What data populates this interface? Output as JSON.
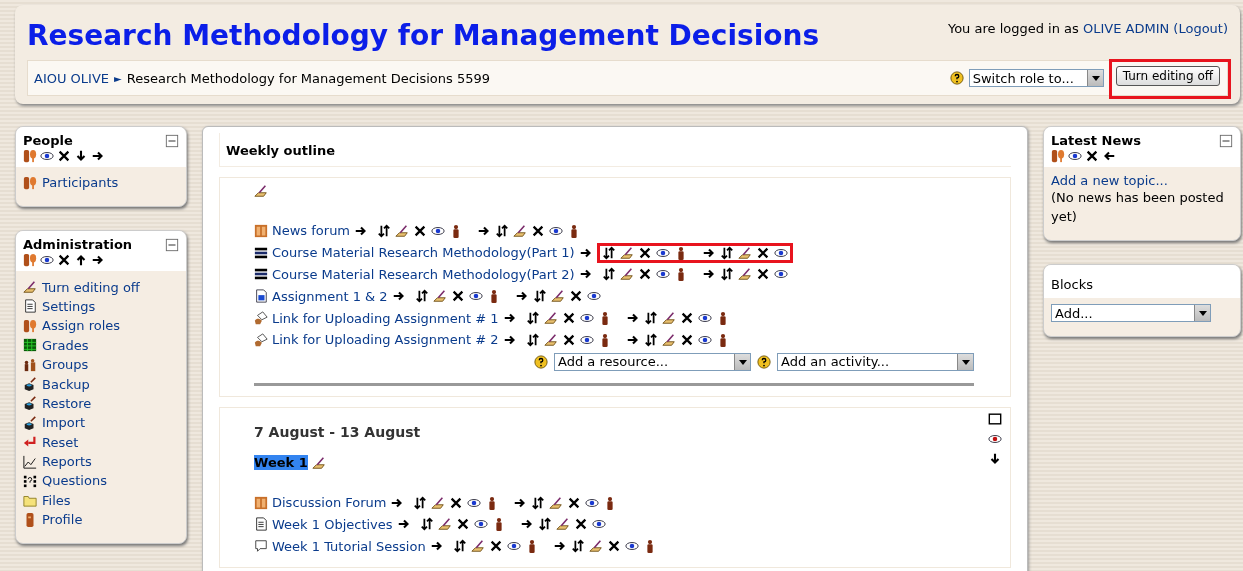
{
  "header": {
    "title": "Research Methodology for Management Decisions",
    "login": {
      "prefix": "You are logged in as",
      "user": "OLIVE ADMIN",
      "logout": "(Logout)"
    },
    "breadcrumb": [
      {
        "label": "AIOU OLIVE",
        "link": true
      },
      {
        "label": "Research Methodology for Management Decisions 5599",
        "link": false
      }
    ],
    "separator": "►",
    "role_select": {
      "value": "Switch role to..."
    },
    "edit_button": {
      "label": "Turn editing off",
      "annotated": true
    }
  },
  "left_blocks": [
    {
      "title": "People",
      "controls": [
        {
          "kind": "roles"
        },
        {
          "kind": "eye"
        },
        {
          "kind": "delete"
        },
        {
          "kind": "down"
        },
        {
          "kind": "right"
        }
      ],
      "items": [
        {
          "kind": "roles",
          "label": "Participants"
        }
      ]
    },
    {
      "title": "Administration",
      "controls": [
        {
          "kind": "roles"
        },
        {
          "kind": "eye"
        },
        {
          "kind": "delete"
        },
        {
          "kind": "up"
        },
        {
          "kind": "right"
        }
      ],
      "items": [
        {
          "kind": "edit",
          "label": "Turn editing off"
        },
        {
          "kind": "page",
          "label": "Settings"
        },
        {
          "kind": "roles",
          "label": "Assign roles"
        },
        {
          "kind": "grades",
          "label": "Grades"
        },
        {
          "kind": "groups",
          "label": "Groups"
        },
        {
          "kind": "box",
          "label": "Backup"
        },
        {
          "kind": "box",
          "label": "Restore"
        },
        {
          "kind": "box",
          "label": "Import"
        },
        {
          "kind": "reset",
          "label": "Reset"
        },
        {
          "kind": "reports",
          "label": "Reports"
        },
        {
          "kind": "questions",
          "label": "Questions"
        },
        {
          "kind": "folder",
          "label": "Files"
        },
        {
          "kind": "profile",
          "label": "Profile"
        }
      ]
    }
  ],
  "outline": {
    "title": "Weekly outline",
    "sections": [
      {
        "activities": [
          {
            "kind": "forum",
            "label": "News forum",
            "annotated": false,
            "control_sets": [
              {
                "group_icon": true
              },
              {
                "group_icon": true
              }
            ]
          },
          {
            "kind": "stack",
            "label": "Course Material Research Methodology(Part 1)",
            "annotated": true,
            "control_sets": [
              {
                "group_icon": true
              },
              {
                "group_icon": false
              }
            ]
          },
          {
            "kind": "stack",
            "label": "Course Material Research Methodology(Part 2)",
            "annotated": false,
            "control_sets": [
              {
                "group_icon": true
              },
              {
                "group_icon": false
              }
            ]
          },
          {
            "kind": "assignment",
            "label": "Assignment 1 & 2",
            "annotated": false,
            "control_sets": [
              {
                "group_icon": true
              },
              {
                "group_icon": false
              }
            ]
          },
          {
            "kind": "link",
            "label": "Link for Uploading Assignment # 1",
            "annotated": false,
            "control_sets": [
              {
                "group_icon": true
              },
              {
                "group_icon": true
              }
            ]
          },
          {
            "kind": "link",
            "label": "Link for Uploading Assignment # 2",
            "annotated": false,
            "control_sets": [
              {
                "group_icon": true
              },
              {
                "group_icon": true
              }
            ]
          }
        ],
        "add_resource": "Add a resource...",
        "add_activity": "Add an activity..."
      },
      {
        "dates": "7 August - 13 August",
        "summary": {
          "label": "Week 1",
          "highlighted": true
        },
        "side_controls": [
          {
            "kind": "square"
          },
          {
            "kind": "eye-red"
          },
          {
            "kind": "down"
          }
        ],
        "activities": [
          {
            "kind": "forum",
            "label": "Discussion Forum",
            "annotated": false,
            "control_sets": [
              {
                "group_icon": true
              },
              {
                "group_icon": true
              }
            ]
          },
          {
            "kind": "page",
            "label": "Week 1 Objectives",
            "annotated": false,
            "control_sets": [
              {
                "group_icon": true
              },
              {
                "group_icon": false
              }
            ]
          },
          {
            "kind": "chat",
            "label": "Week 1 Tutorial Session",
            "annotated": false,
            "control_sets": [
              {
                "group_icon": true
              },
              {
                "group_icon": true
              }
            ]
          }
        ]
      }
    ]
  },
  "right_blocks": [
    {
      "kind": "news",
      "title": "Latest News",
      "controls": [
        {
          "kind": "roles"
        },
        {
          "kind": "eye"
        },
        {
          "kind": "delete"
        },
        {
          "kind": "left"
        }
      ],
      "link": "Add a new topic...",
      "text": "(No news has been posted yet)"
    },
    {
      "kind": "add_block",
      "title": "Blocks",
      "select": "Add..."
    }
  ]
}
